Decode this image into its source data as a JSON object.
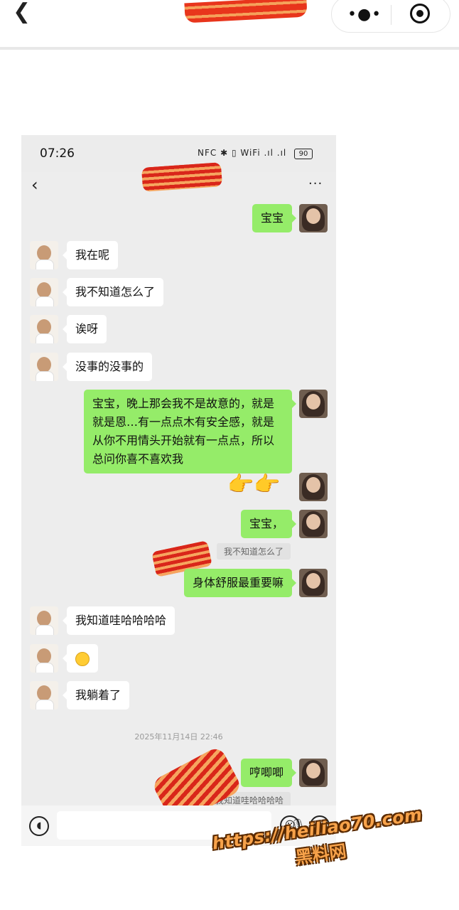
{
  "miniapp": {
    "more_icon": "more-dots-icon",
    "target_icon": "target-icon"
  },
  "phone": {
    "status": {
      "time": "07:26",
      "icons": "NFC ✱ ▯ WiFi .ıl .ıl",
      "battery": "90"
    },
    "chat": {
      "more": "···",
      "messages": [
        {
          "side": "right",
          "text": "宝宝"
        },
        {
          "side": "left",
          "text": "我在呢"
        },
        {
          "side": "left",
          "text": "我不知道怎么了"
        },
        {
          "side": "left",
          "text": "诶呀"
        },
        {
          "side": "left",
          "text": "没事的没事的"
        },
        {
          "side": "right",
          "text": "宝宝，晚上那会我不是故意的，就是就是恩…有一点点木有安全感，就是从你不用情头开始就有一点点，所以总问你喜不喜欢我"
        },
        {
          "side": "right",
          "text": "👉👉"
        },
        {
          "side": "right",
          "text": "宝宝，"
        },
        {
          "side": "quote",
          "text": "我不知道怎么了"
        },
        {
          "side": "right",
          "text": "身体舒服最重要嘛"
        },
        {
          "side": "left",
          "text": "我知道哇哈哈哈哈"
        },
        {
          "side": "left",
          "emoji": "upside-down-smile"
        },
        {
          "side": "left",
          "text": "我躺着了"
        },
        {
          "side": "time",
          "text": "2025年11月14日 22:46"
        },
        {
          "side": "right",
          "text": "哼唧唧"
        },
        {
          "side": "quote",
          "text": "我知道哇哈哈哈哈"
        }
      ]
    }
  },
  "watermark": {
    "url": "https://heiliao70.com",
    "name": "黑料网"
  }
}
